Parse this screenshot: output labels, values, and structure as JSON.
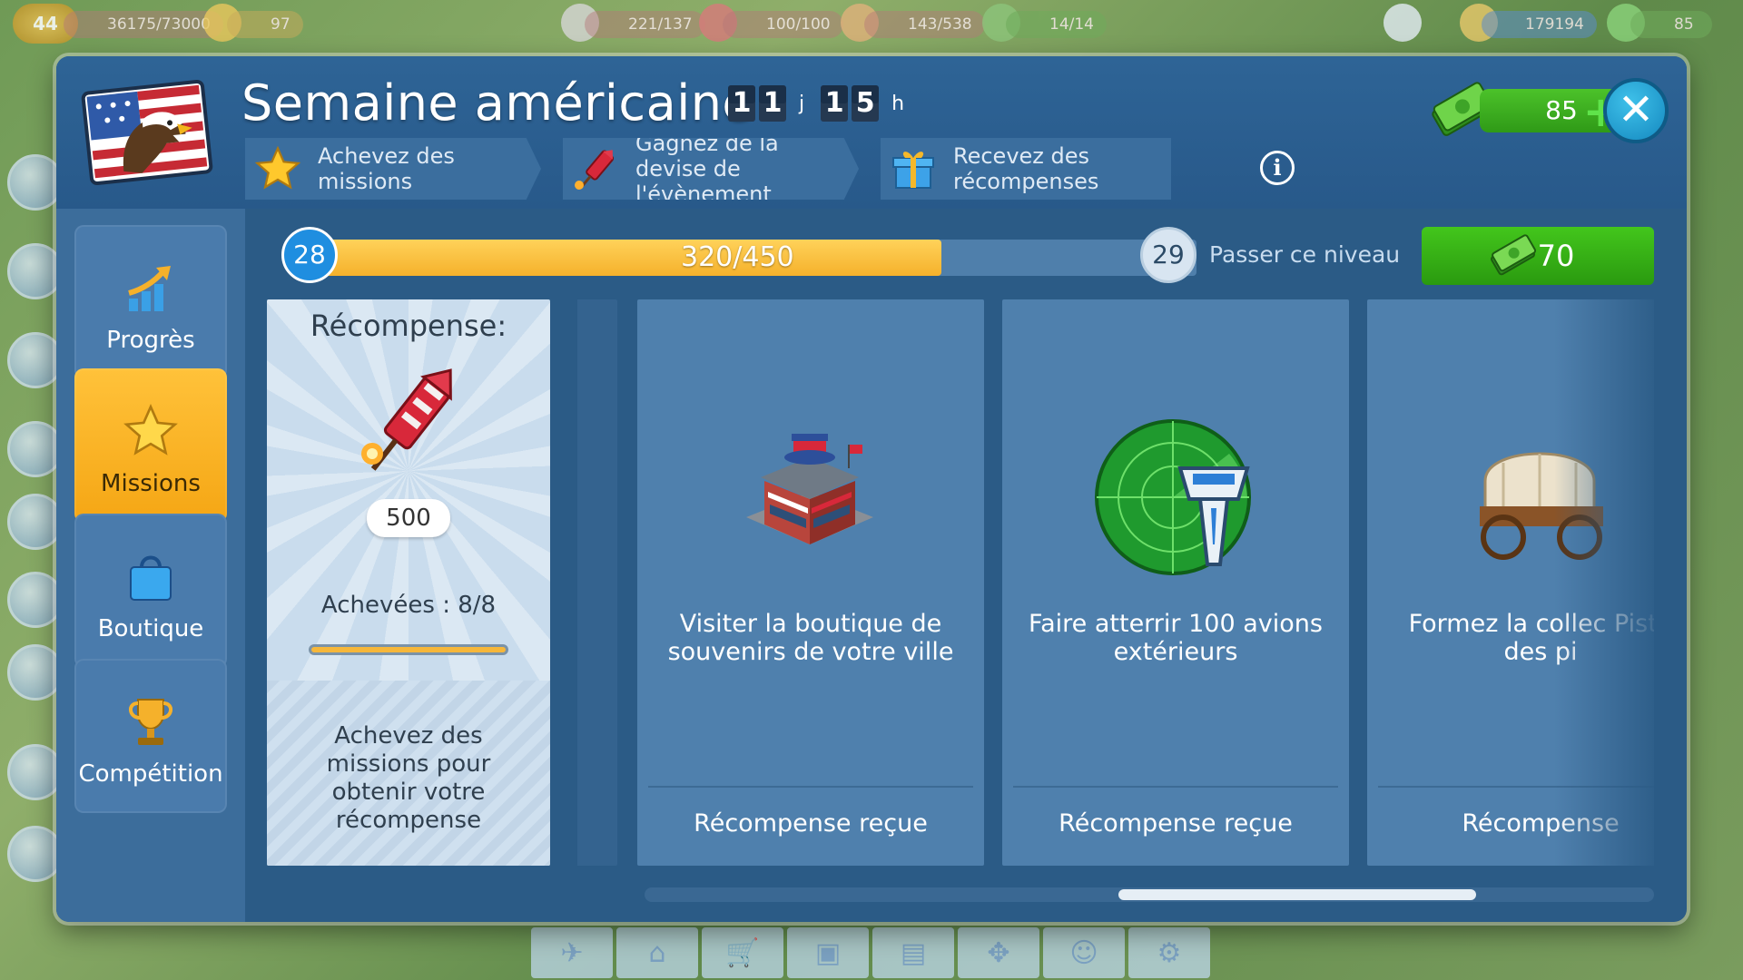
{
  "hud": {
    "player_level": "44",
    "xp": "36175/73000",
    "stars": "97",
    "fuel": "221/137",
    "gas": "100/100",
    "cargo": "143/538",
    "staff": "14/14",
    "coins": "179194",
    "cash": "85"
  },
  "event": {
    "title": "Semaine américaine",
    "timer_days": [
      "1",
      "1"
    ],
    "timer_days_unit": "j",
    "timer_hours": [
      "1",
      "5"
    ],
    "timer_hours_unit": "h",
    "steps": [
      {
        "label": "Achevez des missions",
        "icon": "star-icon"
      },
      {
        "label": "Gagnez de la devise de l'évènement",
        "icon": "firework-icon"
      },
      {
        "label": "Recevez des récompenses",
        "icon": "gift-icon"
      }
    ],
    "cash_balance": "85"
  },
  "sidebar": {
    "items": [
      {
        "label": "Progrès",
        "icon": "progress-chart-icon",
        "active": false
      },
      {
        "label": "Missions",
        "icon": "star-icon",
        "active": true
      },
      {
        "label": "Boutique",
        "icon": "shopping-bag-icon",
        "active": false
      },
      {
        "label": "Compétition",
        "icon": "trophy-icon",
        "active": false
      }
    ]
  },
  "progress": {
    "current_level": "28",
    "next_level": "29",
    "points": "320/450",
    "skip_label": "Passer ce niveau",
    "skip_price": "70"
  },
  "reward": {
    "title": "Récompense:",
    "amount": "500",
    "completed": "Achevées : 8/8",
    "footer": "Achevez des missions pour obtenir votre récompense"
  },
  "missions": [
    {
      "title": "Visiter la boutique de souvenirs de votre ville",
      "status": "Récompense reçue",
      "icon": "souvenir-shop-icon"
    },
    {
      "title": "Faire atterrir 100 avions extérieurs",
      "status": "Récompense reçue",
      "icon": "control-tower-radar-icon"
    },
    {
      "title": "Formez la collec Piste des pi",
      "status": "Récompense",
      "icon": "covered-wagon-icon"
    }
  ],
  "colors": {
    "window_bg": "#2b5b86",
    "active_tab": "#ffc23a",
    "progress_fill": "#f5b12b",
    "skip_button": "#2a9a0f"
  }
}
